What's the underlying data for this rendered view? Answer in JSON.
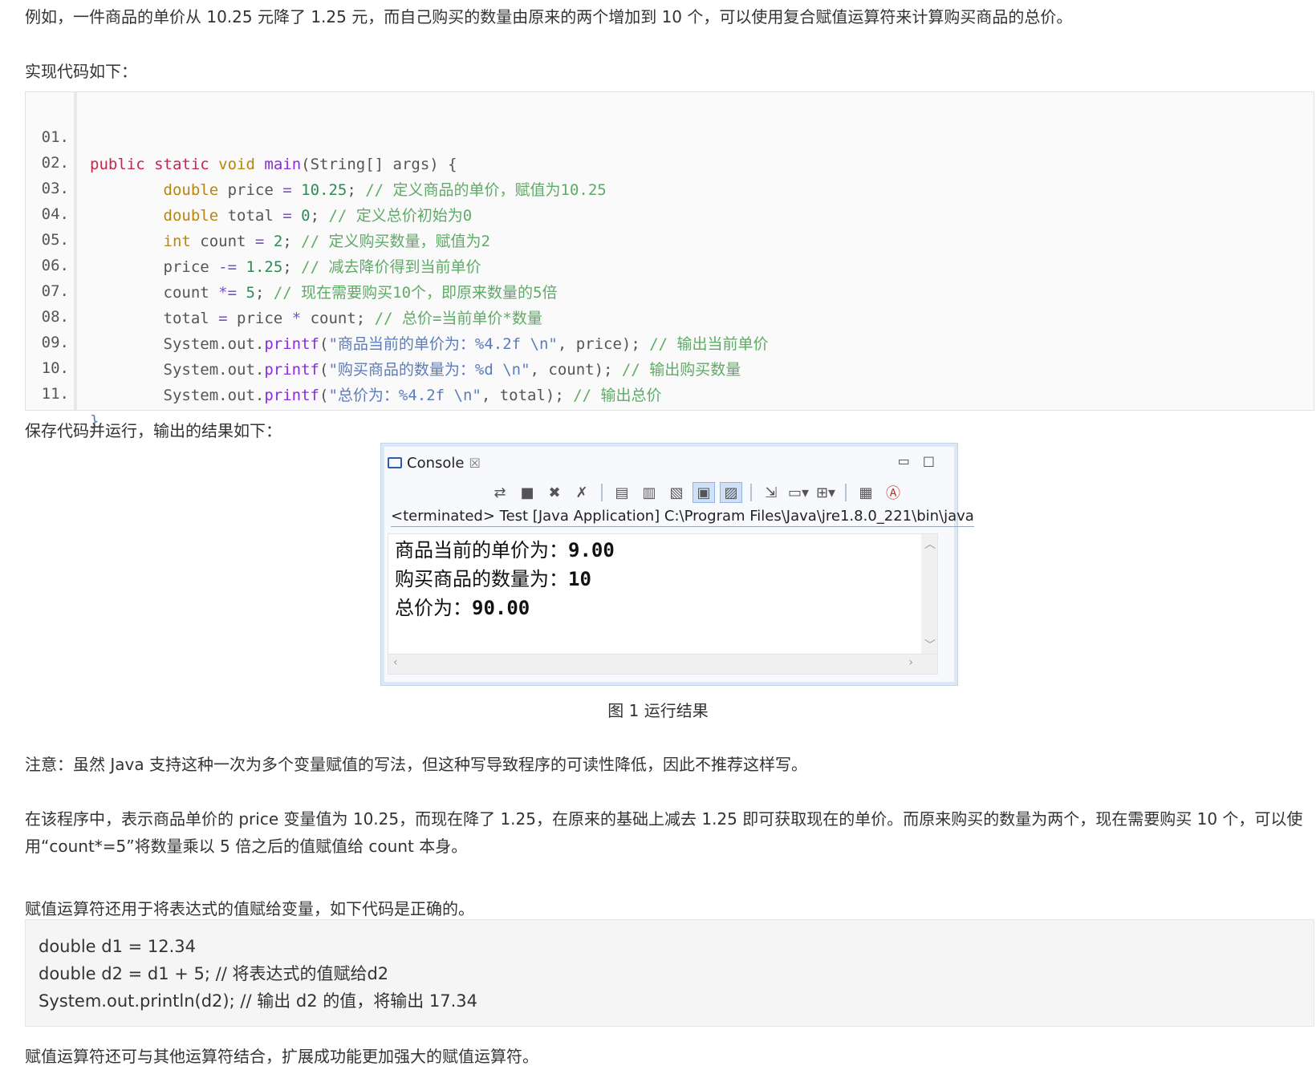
{
  "p1": "例如，一件商品的单价从 10.25 元降了 1.25 元，而自己购买的数量由原来的两个增加到 10 个，可以使用复合赋值运算符来计算购买商品的总价。",
  "p2": "实现代码如下：",
  "code": {
    "line_numbers": [
      "01.",
      "02.",
      "03.",
      "04.",
      "05.",
      "06.",
      "07.",
      "08.",
      "09.",
      "10.",
      "11."
    ],
    "lines": [
      "public static void main(String[] args) {",
      "        double price = 10.25; // 定义商品的单价，赋值为10.25",
      "        double total = 0; // 定义总价初始为0",
      "        int count = 2; // 定义购买数量，赋值为2",
      "        price -= 1.25; // 减去降价得到当前单价",
      "        count *= 5; // 现在需要购买10个，即原来数量的5倍",
      "        total = price * count; // 总价=当前单价*数量",
      "        System.out.printf(\"商品当前的单价为：%4.2f \\n\", price); // 输出当前单价",
      "        System.out.printf(\"购买商品的数量为：%d \\n\", count); // 输出购买数量",
      "        System.out.printf(\"总价为：%4.2f \\n\", total); // 输出总价",
      "}"
    ]
  },
  "p3": "保存代码并运行，输出的结果如下：",
  "console": {
    "tab_label": "Console",
    "close_glyph": "☒",
    "terminated_text": "<terminated> Test [Java Application] C:\\Program Files\\Java\\jre1.8.0_221\\bin\\java",
    "output": [
      {
        "label": "商品当前的单价为：",
        "value": "9.00"
      },
      {
        "label": "购买商品的数量为：",
        "value": "10"
      },
      {
        "label": "总价为：",
        "value": "90.00"
      }
    ]
  },
  "caption": "图 1  运行结果",
  "p4": "注意：虽然 Java 支持这种一次为多个变量赋值的写法，但这种写导致程序的可读性降低，因此不推荐这样写。",
  "p5": "在该程序中，表示商品单价的 price 变量值为 10.25，而现在降了 1.25，在原来的基础上减去 1.25 即可获取现在的单价。而原来购买的数量为两个，现在需要购买 10 个，可以使用“count*=5”将数量乘以 5 倍之后的值赋值给 count 本身。",
  "p7": "赋值运算符还用于将表达式的值赋给变量，如下代码是正确的。",
  "code2": [
    "double d1 = 12.34",
    "double d2 = d1 + 5; // 将表达式的值赋给d2",
    "System.out.println(d2); // 输出 d2 的值，将输出 17.34"
  ],
  "p8": "赋值运算符还可与其他运算符结合，扩展成功能更加强大的赋值运算符。"
}
